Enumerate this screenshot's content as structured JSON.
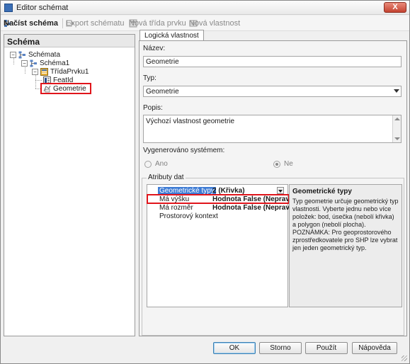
{
  "window": {
    "title": "Editor schémat",
    "close_label": "X"
  },
  "toolbar": {
    "load_schema": "Načíst schéma",
    "export_schema": "Export schématu",
    "new_feature_class": "Nová třída prvku",
    "new_property": "Nová vlastnost"
  },
  "left_panel": {
    "header": "Schéma",
    "tree": [
      {
        "label": "Schémata",
        "toggle": "−"
      },
      {
        "label": "Schéma1",
        "toggle": "−"
      },
      {
        "label": "TřídaPrvku1",
        "toggle": "−"
      },
      {
        "label": "FeatId"
      },
      {
        "label": "Geometrie"
      }
    ]
  },
  "right_panel": {
    "tab_label": "Logická vlastnost",
    "name_label": "Název:",
    "name_value": "Geometrie",
    "type_label": "Typ:",
    "type_value": "Geometrie",
    "desc_label": "Popis:",
    "desc_value": "Výchozí vlastnost geometrie",
    "generated_label": "Vygenerováno systémem:",
    "radio_yes": "Ano",
    "radio_no": "Ne",
    "attributes_group": "Atributy dat",
    "properties": [
      {
        "name": "Geometrické typy",
        "value": "2 (Křivka)"
      },
      {
        "name": "Má výšku",
        "value": "Hodnota False (Nepravda)"
      },
      {
        "name": "Má rozměr",
        "value": "Hodnota False (Nepravda)"
      },
      {
        "name": "Prostorový kontext",
        "value": ""
      }
    ],
    "info_title": "Geometrické typy",
    "info_text": "Typ geometrie určuje geometrický typ vlastnosti. Vyberte jednu nebo více položek: bod, úsečka (nebolí křivka) a polygon (nebolí plocha). POZNÁMKA: Pro geoprostorového zprostředkovatele pro SHP lze vybrat jen jeden geometrický typ."
  },
  "buttons": {
    "ok": "OK",
    "cancel": "Storno",
    "apply": "Použít",
    "help": "Nápověda"
  },
  "colors": {
    "highlight": "#e0151b",
    "selection": "#3d7bd4"
  }
}
